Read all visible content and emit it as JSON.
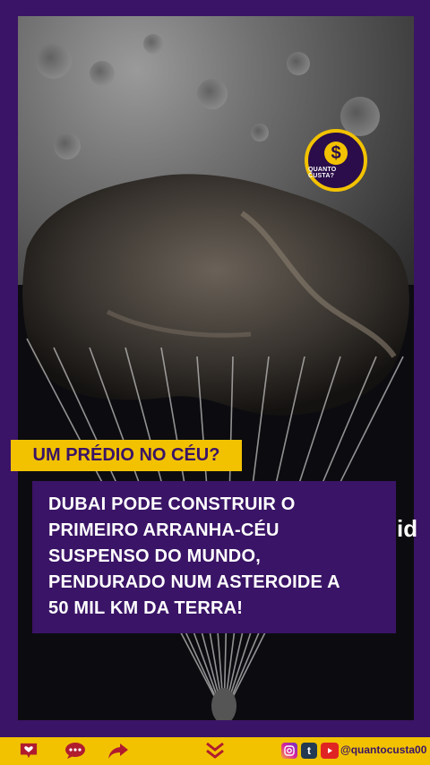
{
  "badge": {
    "symbol": "$",
    "text": "QUANTO CUSTA?"
  },
  "tag": {
    "text": "UM PRÉDIO NO CÉU?"
  },
  "headline": {
    "lines": [
      "DUBAI PODE CONSTRUIR O",
      "PRIMEIRO ARRANHA-CÉU",
      "SUSPENSO DO MUNDO,",
      "PENDURADO NUM ASTEROIDE A",
      "50 MIL KM DA TERRA!"
    ]
  },
  "side_fragment": "id",
  "bottom_bar": {
    "handle": "@quantocusta00",
    "icons": [
      "heart-icon",
      "comment-icon",
      "share-icon",
      "chevron-double-down-icon",
      "instagram-icon",
      "tumblr-icon",
      "youtube-icon"
    ]
  },
  "colors": {
    "purple": "#3a1466",
    "yellow": "#f2c200"
  }
}
